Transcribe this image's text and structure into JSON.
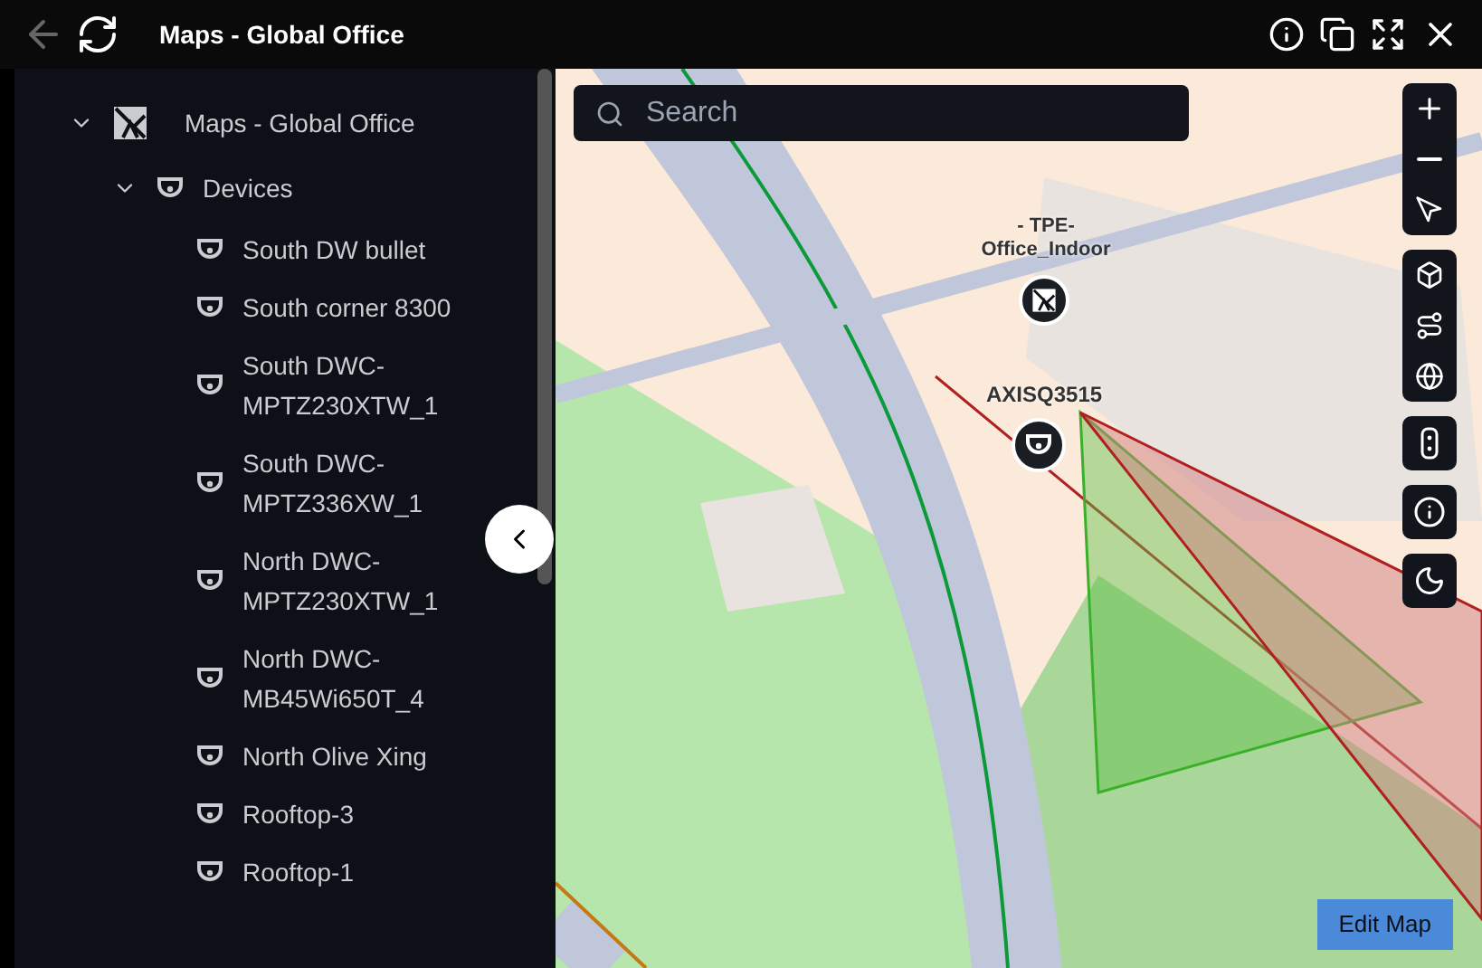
{
  "window": {
    "title": "Maps - Global Office"
  },
  "tree": [
    {
      "label": "Maps - Global Office",
      "kind": "map",
      "expanded": true,
      "children": [
        {
          "label": "Devices",
          "kind": "group",
          "expanded": true,
          "children": [
            {
              "label": "South DW bullet",
              "kind": "camera"
            },
            {
              "label": "South corner 8300",
              "kind": "camera"
            },
            {
              "label": "South DWC-MPTZ230XTW_1",
              "kind": "camera"
            },
            {
              "label": "South DWC-MPTZ336XW_1",
              "kind": "camera"
            },
            {
              "label": "North DWC-MPTZ230XTW_1",
              "kind": "camera"
            },
            {
              "label": "North DWC-MB45Wi650T_4",
              "kind": "camera"
            },
            {
              "label": "North Olive Xing",
              "kind": "camera"
            },
            {
              "label": "Rooftop-3",
              "kind": "camera"
            },
            {
              "label": "Rooftop-1",
              "kind": "camera"
            }
          ]
        }
      ]
    }
  ],
  "map": {
    "search": {
      "placeholder": "Search"
    },
    "markers": [
      {
        "label": "- TPE-Office_Indoor",
        "kind": "map"
      },
      {
        "label": "AXISQ3515",
        "kind": "camera"
      }
    ],
    "edit_button": "Edit Map"
  }
}
